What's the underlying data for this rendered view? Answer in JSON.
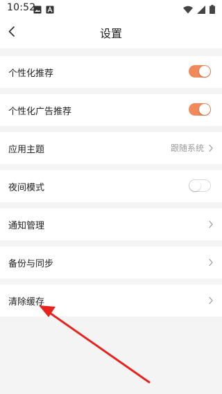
{
  "status_bar": {
    "time": "10:52",
    "left_icons": [
      "image-icon",
      "font-icon"
    ],
    "right_icons": [
      "wifi-icon",
      "signal-icon",
      "battery-icon"
    ]
  },
  "header": {
    "back_icon": "chevron-left-icon",
    "title": "设置"
  },
  "settings": {
    "personalized_recommend": {
      "label": "个性化推荐",
      "enabled": true
    },
    "personalized_ads": {
      "label": "个性化广告推荐",
      "enabled": true
    },
    "app_theme": {
      "label": "应用主题",
      "value": "跟随系统"
    },
    "night_mode": {
      "label": "夜间模式",
      "enabled": false
    },
    "notifications": {
      "label": "通知管理"
    },
    "backup_sync": {
      "label": "备份与同步"
    },
    "clear_cache": {
      "label": "清除缓存"
    }
  },
  "colors": {
    "accent": "#f08a5a",
    "annotation_arrow": "#e8231f"
  }
}
